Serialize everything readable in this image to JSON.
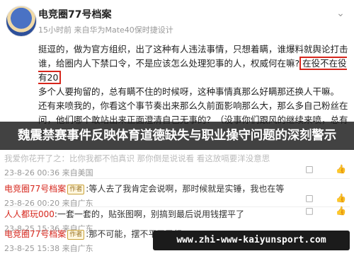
{
  "post": {
    "author": "电竞圈77号档案",
    "meta": "15小时前  来自华为Mate40保时捷设计",
    "lines": [
      "挺逗的，做为官方组织，出了这种有人违法事情，只想着瞒，谁爆料就舆论打击",
      "谁，给圈内人下禁口令，不是应该怎么处理犯事的人，权威何在嘛?",
      "在役不在役有20",
      "多个人要拘留的，总有瞒不住的时候呀，这种事情真那么好瞒那还换人干嘛。",
      "还有来喷我的，你看这个事节奏出来那么久前面影响那么大，那么多自己粉丝在",
      "问，他们哪个敢站出来正面澄清自己无事的？（没事你们跟风的继续来喷，总有执"
    ]
  },
  "banner": {
    "text": "魏震禁赛事件反映体育道德缺失与职业操守问题的深刻警示"
  },
  "comments": [
    {
      "faded_text": "我爱你花开了之：比你我都不怕真识 那你倒是说说看 看这放嗝要洋没意思",
      "meta": "23-8-26 00:36  来自美国"
    },
    {
      "author": "电竞圈77号档案",
      "tag": "作者",
      "text": ":等人去了我肯定会说啊，那时候就是实锤，我也在等",
      "meta": "23-8-26 00:20  来自广东"
    },
    {
      "author": "人人都玩000",
      "text": ":一套一套的，贴张图啊，别搞到最后说用钱摆平了",
      "meta": "23-8-25 15:36  来自广东"
    },
    {
      "author": "电竞圈77号档案",
      "tag": "作者",
      "text": ":那不可能，摆不平了已经",
      "meta": "23-8-25 15:38  来自广东"
    }
  ],
  "watermark": {
    "text": "www.zhi-www-kaiyunsport.com"
  }
}
